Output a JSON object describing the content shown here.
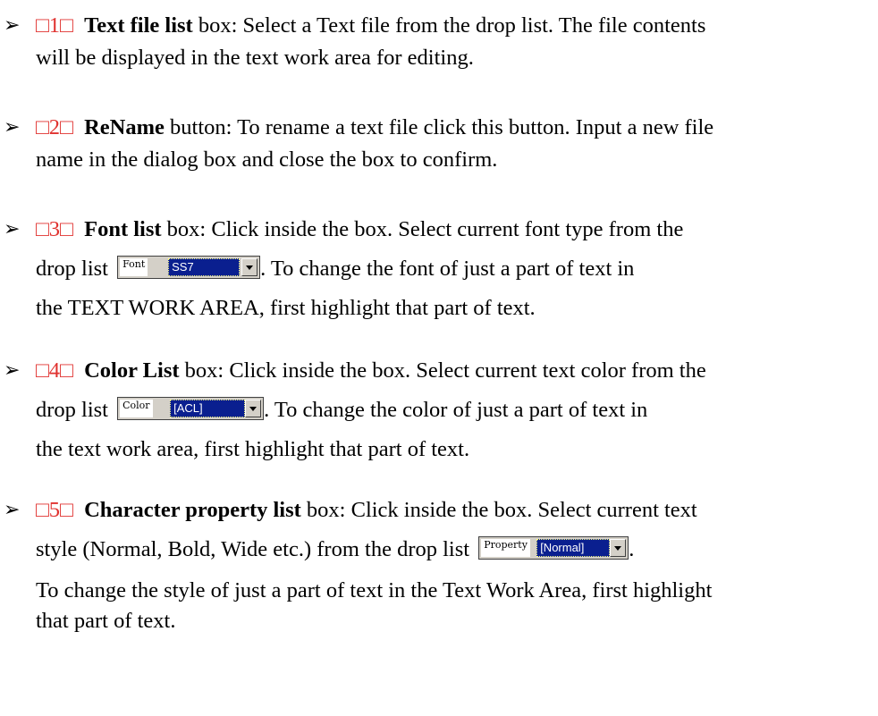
{
  "items": [
    {
      "arrow": "➢",
      "number": "□1□",
      "bold": "Text file list",
      "line1": " box: Select a Text file from the drop list. The file contents",
      "line2": "will be displayed in the text work area for editing."
    },
    {
      "arrow": "➢",
      "number": "□2□",
      "bold": "ReName",
      "line1": " button: To rename a text file click this button. Input a new file",
      "line2": "name in the dialog box and close the box to confirm."
    },
    {
      "arrow": "➢",
      "number": "□3□",
      "bold": "Font list",
      "line1": " box: Click inside the box. Select current font type from the",
      "pre_widget": "drop list",
      "widget_label": "Font",
      "widget_value": "SS7",
      "post_widget": ". To change the font of just a part of text in",
      "line3": "the TEXT WORK AREA, first highlight that part of text."
    },
    {
      "arrow": "➢",
      "number": "□4□",
      "bold": "Color List",
      "line1": " box: Click inside the box. Select current text color from the",
      "pre_widget": "drop list",
      "widget_label": "Color",
      "widget_value": "[ACL]",
      "post_widget": ". To change the color of just a part of text in",
      "line3": "the text work area, first highlight that part of text."
    },
    {
      "arrow": "➢",
      "number": "□5□",
      "bold": "Character property list",
      "line1": " box: Click inside the box. Select current text",
      "pre_widget": "style (Normal, Bold, Wide etc.) from the drop list",
      "widget_label": "Property",
      "widget_value": "[Normal]",
      "post_widget": ".",
      "line3": "To change the style of just a part of text in the Text Work Area, first highlight",
      "line4": "that part of text."
    }
  ]
}
